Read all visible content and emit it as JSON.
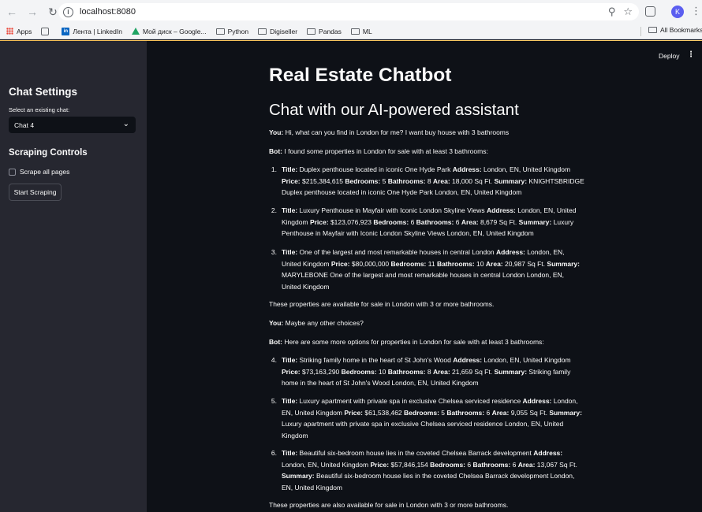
{
  "browser": {
    "url": "localhost:8080",
    "bookmarks": [
      {
        "icon": "apps-grid-icon",
        "label": "Apps"
      },
      {
        "icon": "tab-groups-icon",
        "label": ""
      },
      {
        "icon": "linkedin-icon",
        "label": "Лента | LinkedIn"
      },
      {
        "icon": "google-drive-icon",
        "label": "Мой диск – Google..."
      },
      {
        "icon": "folder-icon",
        "label": "Python"
      },
      {
        "icon": "folder-icon",
        "label": "Digiseller"
      },
      {
        "icon": "folder-icon",
        "label": "Pandas"
      },
      {
        "icon": "folder-icon",
        "label": "ML"
      }
    ],
    "all_bookmarks": "All Bookmarks",
    "profile_initial": "K"
  },
  "sidebar": {
    "title": "Chat Settings",
    "select_label": "Select an existing chat:",
    "selected_chat": "Chat 4",
    "scraping_title": "Scraping Controls",
    "checkbox_label": "Scrape all pages",
    "button_label": "Start Scraping"
  },
  "header": {
    "deploy": "Deploy"
  },
  "main": {
    "title": "Real Estate Chatbot",
    "subtitle": "Chat with our AI-powered assistant",
    "you1_label": "You:",
    "you1_text": " Hi, what can you find in London for me? I want buy house with 3 bathrooms",
    "bot1_label": "Bot:",
    "bot1_text": " I found some properties in London for sale with at least 3 bathrooms:",
    "items": [
      {
        "num": "1.",
        "title": "Duplex penthouse located in iconic One Hyde Park",
        "address": "London, EN, United Kingdom",
        "price": "$215,384,615",
        "bedrooms": "5",
        "bathrooms": "8",
        "area": "18,000 Sq Ft.",
        "summary": "KNIGHTSBRIDGE Duplex penthouse located in iconic One Hyde Park London, EN, United Kingdom"
      },
      {
        "num": "2.",
        "title": "Luxury Penthouse in Mayfair with Iconic London Skyline Views",
        "address": "London, EN, United Kingdom",
        "price": "$123,076,923",
        "bedrooms": "6",
        "bathrooms": "6",
        "area": "8,679 Sq Ft.",
        "summary": "Luxury Penthouse in Mayfair with Iconic London Skyline Views London, EN, United Kingdom"
      },
      {
        "num": "3.",
        "title": "One of the largest and most remarkable houses in central London",
        "address": "London, EN, United Kingdom",
        "price": "$80,000,000",
        "bedrooms": "11",
        "bathrooms": "10",
        "area": "20,987 Sq Ft.",
        "summary": "MARYLEBONE One of the largest and most remarkable houses in central London London, EN, United Kingdom"
      },
      {
        "num": "4.",
        "title": "Striking family home in the heart of St John's Wood",
        "address": "London, EN, United Kingdom",
        "price": "$73,163,290",
        "bedrooms": "10",
        "bathrooms": "8",
        "area": "21,659 Sq Ft.",
        "summary": "Striking family home in the heart of St John's Wood London, EN, United Kingdom"
      },
      {
        "num": "5.",
        "title": "Luxury apartment with private spa in exclusive Chelsea serviced residence",
        "address": "London, EN, United Kingdom",
        "price": "$61,538,462",
        "bedrooms": "5",
        "bathrooms": "6",
        "area": "9,055 Sq Ft.",
        "summary": "Luxury apartment with private spa in exclusive Chelsea serviced residence London, EN, United Kingdom"
      },
      {
        "num": "6.",
        "title": "Beautiful six-bedroom house lies in the coveted Chelsea Barrack development",
        "address": "London, EN, United Kingdom",
        "price": "$57,846,154",
        "bedrooms": "6",
        "bathrooms": "6",
        "area": "13,067 Sq Ft.",
        "summary": "Beautiful six-bedroom house lies in the coveted Chelsea Barrack development London, EN, United Kingdom"
      }
    ],
    "note1": "These properties are available for sale in London with 3 or more bathrooms.",
    "you2_label": "You:",
    "you2_text": " Maybe any other choices?",
    "bot2_label": "Bot:",
    "bot2_text": " Here are some more options for properties in London for sale with at least 3 bathrooms:",
    "note2": "These properties are also available for sale in London with 3 or more bathrooms.",
    "field_labels": {
      "title": "Title:",
      "address": "Address:",
      "price": "Price:",
      "bedrooms": "Bedrooms:",
      "bathrooms": "Bathrooms:",
      "area": "Area:",
      "summary": "Summary:"
    }
  }
}
